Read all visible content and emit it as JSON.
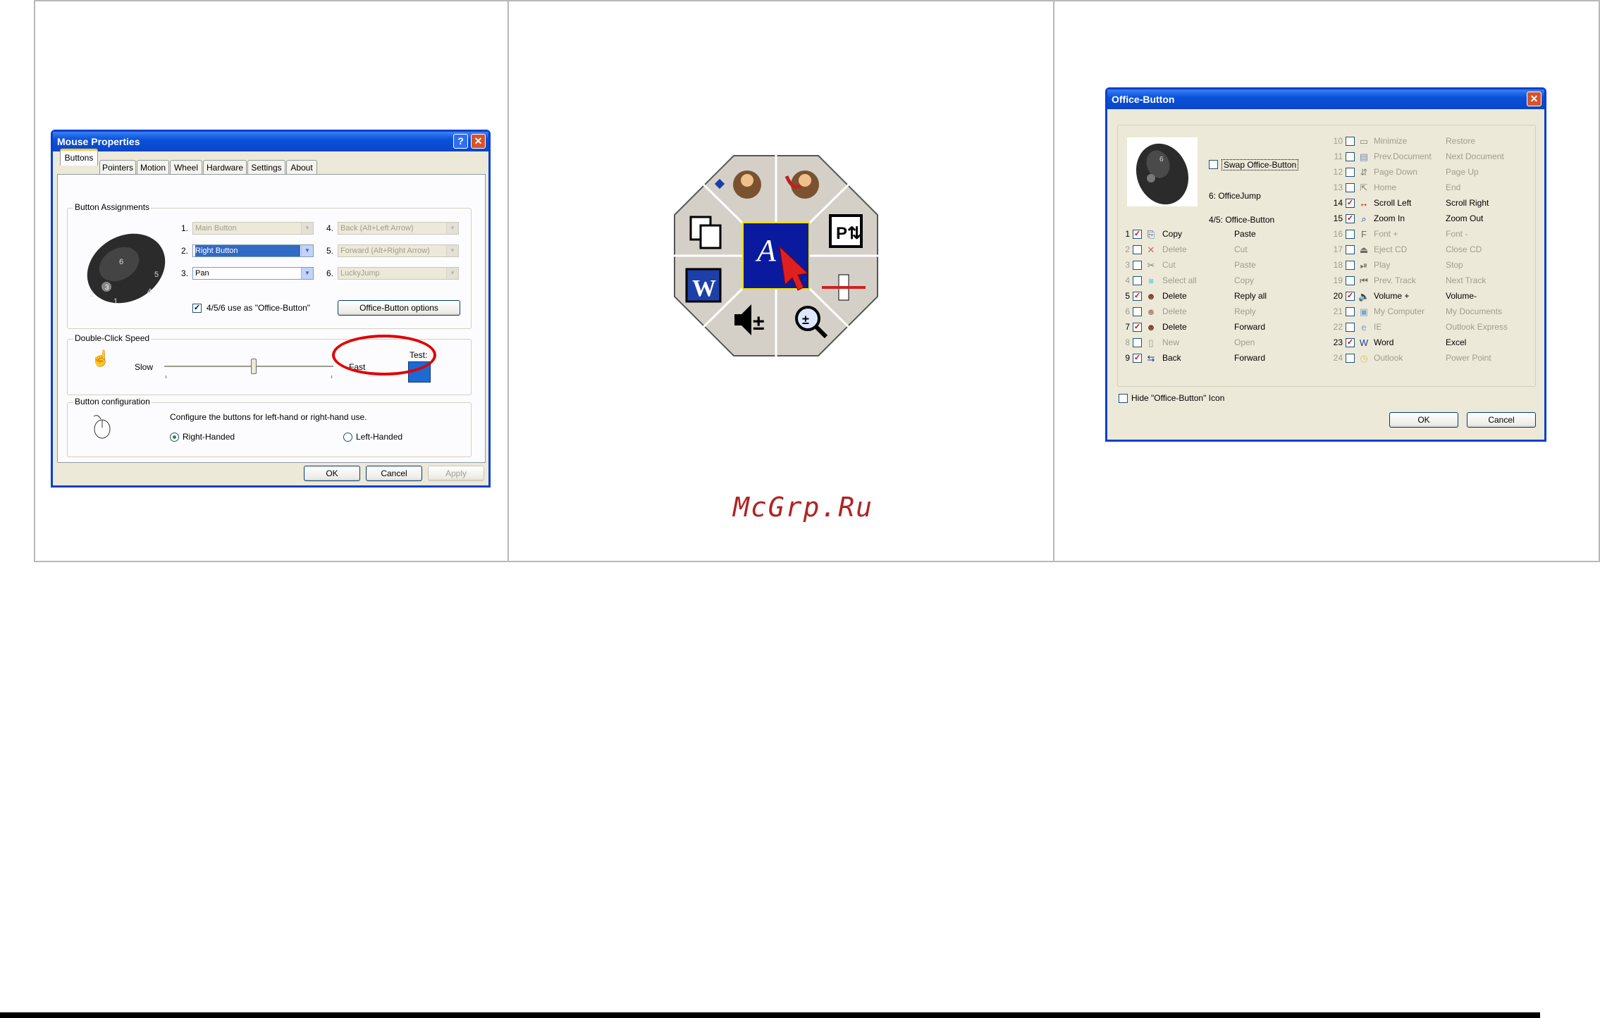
{
  "mouse_props": {
    "title": "Mouse Properties",
    "help_btn": "?",
    "close_btn": "✕",
    "tabs": [
      "Buttons",
      "Pointers",
      "Motion",
      "Wheel",
      "Hardware",
      "Settings",
      "About"
    ],
    "assign_group": "Button Assignments",
    "nums": [
      "1.",
      "2.",
      "3.",
      "4.",
      "5.",
      "6."
    ],
    "sel1": "Main Button",
    "sel2": "Right Button",
    "sel3": "Pan",
    "sel4": "Back (Alt+Left Arrow)",
    "sel5": "Forward (Alt+Right Arrow)",
    "sel6": "LuckyJump",
    "office_check_label": "4/5/6 use as \"Office-Button\"",
    "office_options_btn": "Office-Button options",
    "dbl_group": "Double-Click Speed",
    "slow": "Slow",
    "fast": "Fast",
    "test": "Test:",
    "config_group": "Button configuration",
    "config_text": "Configure the buttons for left-hand or right-hand use.",
    "right_handed": "Right-Handed",
    "left_handed": "Left-Handed",
    "ok": "OK",
    "cancel": "Cancel",
    "apply": "Apply"
  },
  "watermark": "McGrp.Ru",
  "office_button": {
    "title": "Office-Button",
    "close_btn": "✕",
    "swap_label": "Swap Office-Button",
    "jump_label": "6: OfficeJump",
    "button45_label": "4/5: Office-Button",
    "hide_label": "Hide \"Office-Button\" Icon",
    "ok": "OK",
    "cancel": "Cancel",
    "left_rows": [
      {
        "num": "1",
        "checked": true,
        "name": "Copy",
        "alt": "Paste",
        "icon_name": "copy-icon",
        "glyph": "⎘",
        "color": "#1f3f9f"
      },
      {
        "num": "2",
        "checked": false,
        "name": "Delete",
        "alt": "Cut",
        "icon_name": "delete-x-icon",
        "glyph": "✕",
        "color": "#b00000"
      },
      {
        "num": "3",
        "checked": false,
        "name": "Cut",
        "alt": "Paste",
        "icon_name": "scissors-icon",
        "glyph": "✂",
        "color": "#333"
      },
      {
        "num": "4",
        "checked": false,
        "name": "Select all",
        "alt": "Copy",
        "icon_name": "select-all-icon",
        "glyph": "■",
        "color": "#3ec7d0"
      },
      {
        "num": "5",
        "checked": true,
        "name": "Delete",
        "alt": "Reply all",
        "icon_name": "reply-all-icon",
        "glyph": "☻",
        "color": "#7a3b1f"
      },
      {
        "num": "6",
        "checked": false,
        "name": "Delete",
        "alt": "Reply",
        "icon_name": "reply-icon",
        "glyph": "☻",
        "color": "#7a3b1f"
      },
      {
        "num": "7",
        "checked": true,
        "name": "Delete",
        "alt": "Forward",
        "icon_name": "forward-icon",
        "glyph": "☻",
        "color": "#7a3b1f"
      },
      {
        "num": "8",
        "checked": false,
        "name": "New",
        "alt": "Open",
        "icon_name": "new-document-icon",
        "glyph": "▯",
        "color": "#555"
      },
      {
        "num": "9",
        "checked": true,
        "name": "Back",
        "alt": "Forward",
        "icon_name": "back-forward-icon",
        "glyph": "⇆",
        "color": "#1f3f9f"
      }
    ],
    "right_rows": [
      {
        "num": "10",
        "checked": false,
        "name": "Minimize",
        "alt": "Restore",
        "icon_name": "minimize-icon",
        "glyph": "▭",
        "color": "#333"
      },
      {
        "num": "11",
        "checked": false,
        "name": "Prev.Document",
        "alt": "Next Document",
        "icon_name": "prev-document-icon",
        "glyph": "▤",
        "color": "#1f3f9f"
      },
      {
        "num": "12",
        "checked": false,
        "name": "Page Down",
        "alt": "Page Up",
        "icon_name": "page-down-icon",
        "glyph": "⇵",
        "color": "#333"
      },
      {
        "num": "13",
        "checked": false,
        "name": "Home",
        "alt": "End",
        "icon_name": "home-end-icon",
        "glyph": "⇱",
        "color": "#333"
      },
      {
        "num": "14",
        "checked": true,
        "name": "Scroll Left",
        "alt": "Scroll Right",
        "icon_name": "scroll-horizontal-icon",
        "glyph": "↔",
        "color": "#c00"
      },
      {
        "num": "15",
        "checked": true,
        "name": "Zoom In",
        "alt": "Zoom Out",
        "icon_name": "zoom-icon",
        "glyph": "⌕",
        "color": "#1f3f9f"
      },
      {
        "num": "16",
        "checked": false,
        "name": "Font +",
        "alt": "Font -",
        "icon_name": "font-size-icon",
        "glyph": "F",
        "color": "#000"
      },
      {
        "num": "17",
        "checked": false,
        "name": "Eject CD",
        "alt": "Close CD",
        "icon_name": "eject-icon",
        "glyph": "⏏",
        "color": "#000"
      },
      {
        "num": "18",
        "checked": false,
        "name": "Play",
        "alt": "Stop",
        "icon_name": "play-pause-icon",
        "glyph": "⏯",
        "color": "#000"
      },
      {
        "num": "19",
        "checked": false,
        "name": "Prev. Track",
        "alt": "Next Track",
        "icon_name": "prev-track-icon",
        "glyph": "⏮",
        "color": "#000"
      },
      {
        "num": "20",
        "checked": true,
        "name": "Volume +",
        "alt": "Volume-",
        "icon_name": "volume-icon",
        "glyph": "🔈",
        "color": "#000"
      },
      {
        "num": "21",
        "checked": false,
        "name": "My Computer",
        "alt": "My Documents",
        "icon_name": "my-computer-icon",
        "glyph": "▣",
        "color": "#2a6db5"
      },
      {
        "num": "22",
        "checked": false,
        "name": "IE",
        "alt": "Outlook Express",
        "icon_name": "ie-icon",
        "glyph": "e",
        "color": "#1e5fc7"
      },
      {
        "num": "23",
        "checked": true,
        "name": "Word",
        "alt": "Excel",
        "icon_name": "word-icon",
        "glyph": "W",
        "color": "#1f3f9f"
      },
      {
        "num": "24",
        "checked": false,
        "name": "Outlook",
        "alt": "Power Point",
        "icon_name": "outlook-icon",
        "glyph": "◷",
        "color": "#c8a000"
      }
    ]
  }
}
